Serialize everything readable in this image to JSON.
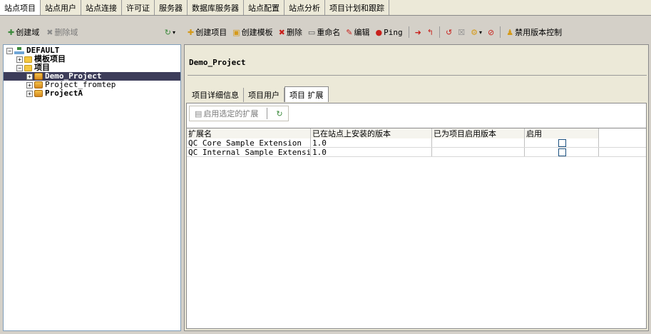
{
  "top_tabs": [
    {
      "label": "站点项目",
      "active": true
    },
    {
      "label": "站点用户"
    },
    {
      "label": "站点连接"
    },
    {
      "label": "许可证"
    },
    {
      "label": "服务器"
    },
    {
      "label": "数据库服务器"
    },
    {
      "label": "站点配置"
    },
    {
      "label": "站点分析"
    },
    {
      "label": "项目计划和跟踪"
    }
  ],
  "left_toolbar": {
    "create_domain": "创建域",
    "delete_domain": "删除域"
  },
  "tree": {
    "root": "DEFAULT",
    "template_projects": "模板项目",
    "projects": "项目",
    "items": [
      "Demo_Project",
      "Project_fromtep",
      "ProjectA"
    ]
  },
  "right_toolbar": {
    "create_project": "创建项目",
    "create_template": "创建模板",
    "delete": "删除",
    "rename": "重命名",
    "edit": "编辑",
    "ping": "Ping",
    "disable_version_control": "禁用版本控制"
  },
  "project_title": "Demo_Project",
  "sub_tabs": [
    {
      "label": "项目详细信息"
    },
    {
      "label": "项目用户"
    },
    {
      "label": "项目 扩展",
      "active": true
    }
  ],
  "ext_toolbar": {
    "enable_selected": "启用选定的扩展"
  },
  "ext_table": {
    "headers": [
      "扩展名",
      "已在站点上安装的版本",
      "已为项目启用版本",
      "启用"
    ],
    "rows": [
      {
        "name": "QC Core Sample Extension",
        "installed": "1.0",
        "enabled_version": "",
        "enabled": false
      },
      {
        "name": "QC Internal Sample Extension",
        "installed": "1.0",
        "enabled_version": "",
        "enabled": false
      }
    ]
  }
}
